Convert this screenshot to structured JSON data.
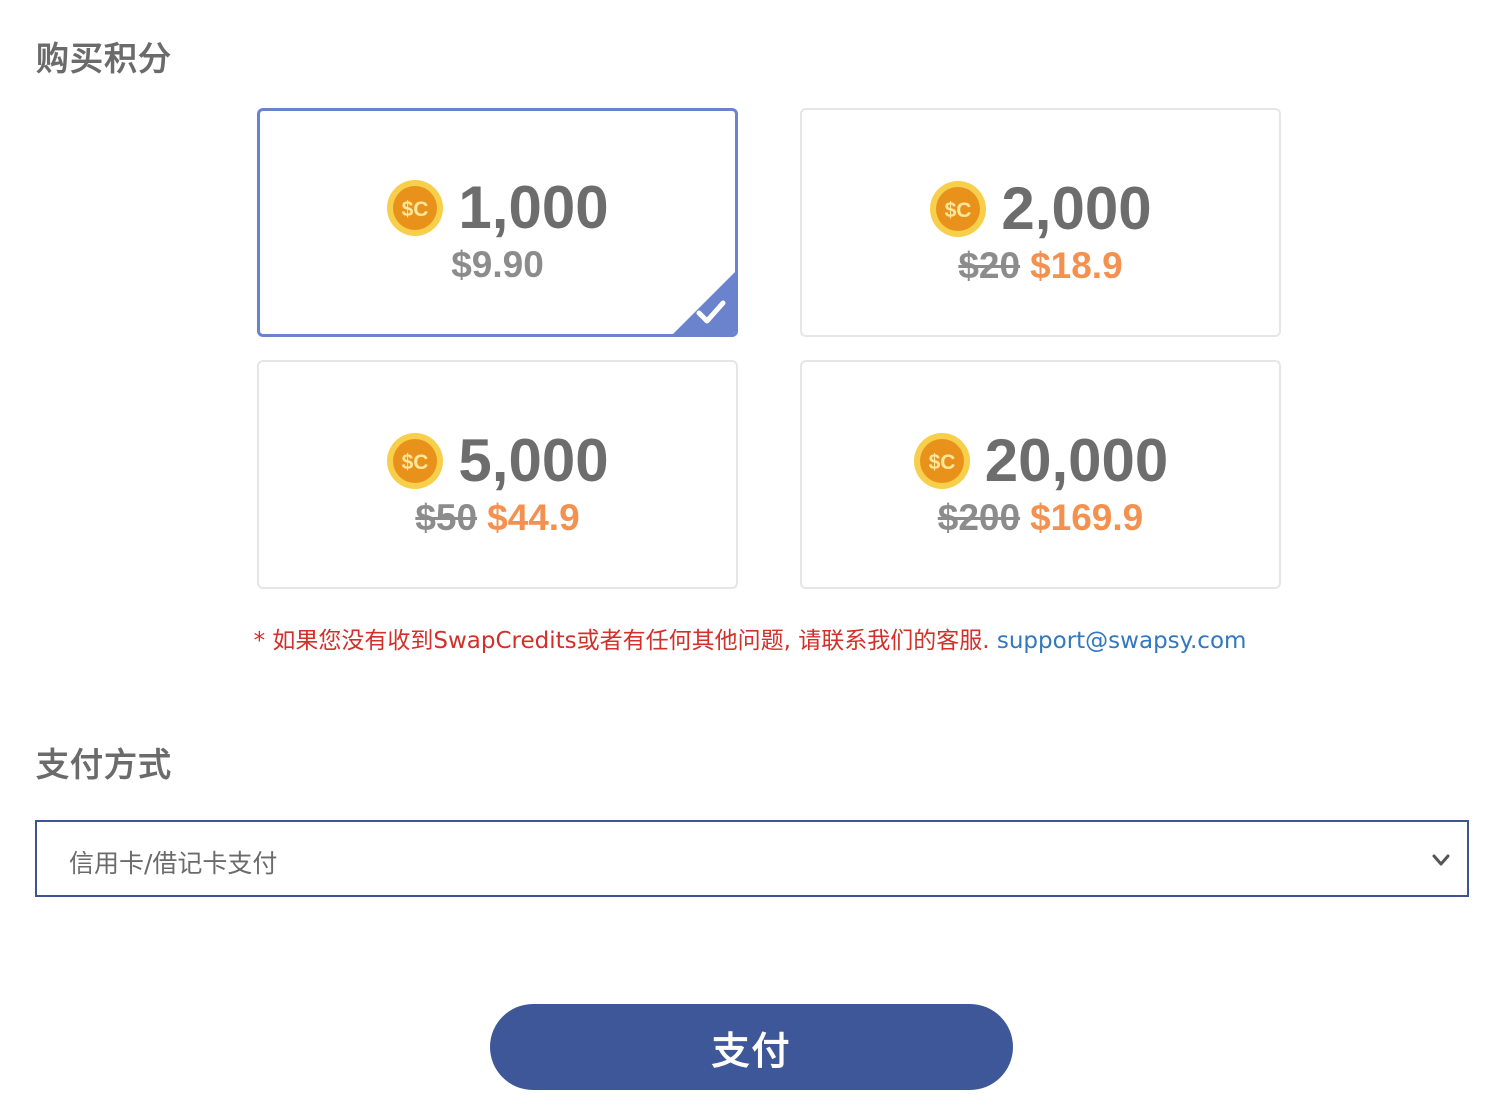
{
  "buy_section": {
    "title": "购买积分"
  },
  "packages": [
    {
      "amount": "1,000",
      "price": "$9.90",
      "selected": true
    },
    {
      "amount": "2,000",
      "old_price": "$20",
      "new_price": "$18.9",
      "selected": false
    },
    {
      "amount": "5,000",
      "old_price": "$50",
      "new_price": "$44.9",
      "selected": false
    },
    {
      "amount": "20,000",
      "old_price": "$200",
      "new_price": "$169.9",
      "selected": false
    }
  ],
  "coin_icon": {
    "name": "sc-coin-icon",
    "label": "$C"
  },
  "notice": {
    "text": "* 如果您没有收到SwapCredits或者有任何其他问题, 请联系我们的客服.",
    "email": "support@swapsy.com"
  },
  "payment_section": {
    "title": "支付方式",
    "selected_method": "信用卡/借记卡支付"
  },
  "pay_button": {
    "label": "支付"
  },
  "colors": {
    "accent": "#3d5799",
    "selected_border": "#6a83cc",
    "discount_price": "#f4914e",
    "notice": "#d2302a",
    "link": "#3278be",
    "coin": "#f0a91c"
  }
}
